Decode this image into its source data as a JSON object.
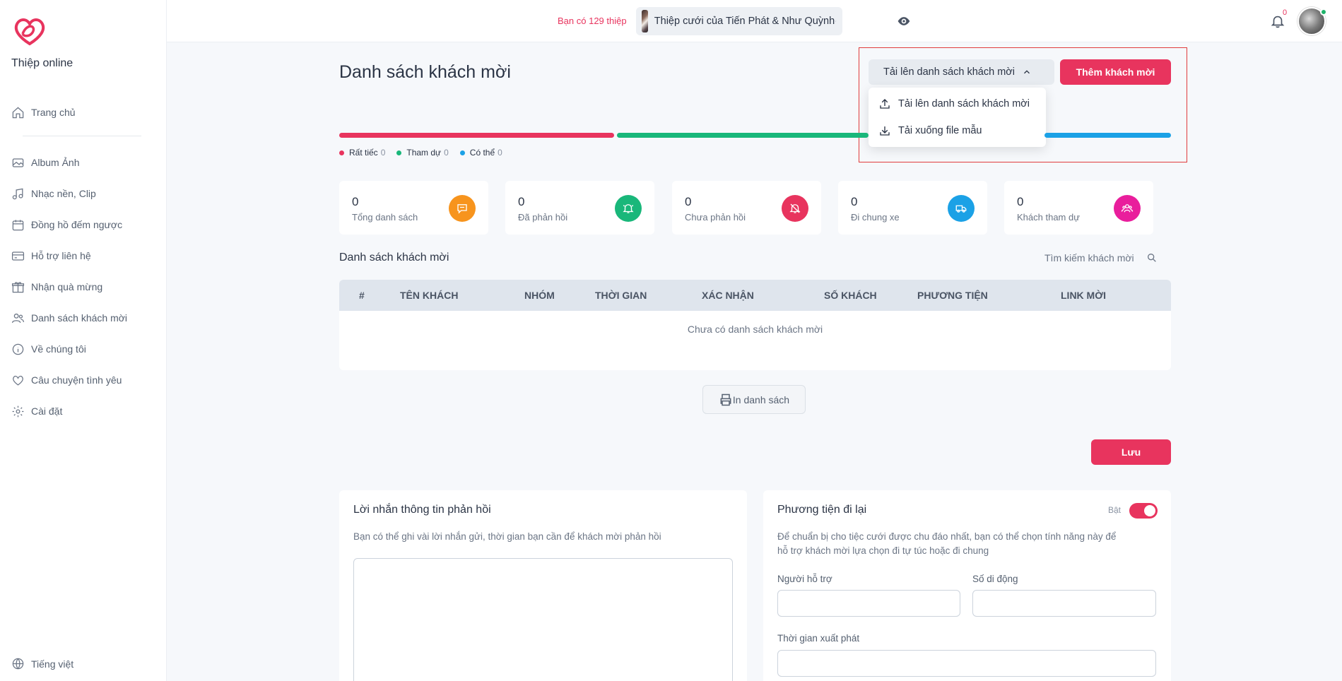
{
  "sidebar": {
    "brand": "Thiệp online",
    "items": [
      {
        "label": "Trang chủ",
        "icon": "home-icon"
      },
      {
        "label": "Album Ảnh",
        "icon": "image-icon"
      },
      {
        "label": "Nhạc nền, Clip",
        "icon": "music-icon"
      },
      {
        "label": "Đồng hồ đếm ngược",
        "icon": "calendar-icon"
      },
      {
        "label": "Hỗ trợ liên hệ",
        "icon": "card-icon"
      },
      {
        "label": "Nhận quà mừng",
        "icon": "gift-icon"
      },
      {
        "label": "Danh sách khách mời",
        "icon": "users-icon"
      },
      {
        "label": "Về chúng tôi",
        "icon": "info-icon"
      },
      {
        "label": "Câu chuyện tình yêu",
        "icon": "heart-icon"
      },
      {
        "label": "Cài đặt",
        "icon": "gear-icon"
      }
    ],
    "language": "Tiếng việt"
  },
  "topbar": {
    "card_count_text": "Bạn có 129 thiệp",
    "selected_card": "Thiệp cưới của Tiến Phát & Như Quỳnh",
    "notification_count": "0"
  },
  "main": {
    "title": "Danh sách khách mời",
    "upload_button": "Tải lên danh sách khách mời",
    "add_button": "Thêm khách mời",
    "dropdown": [
      {
        "label": "Tải lên danh sách khách mời",
        "icon": "upload-icon"
      },
      {
        "label": "Tải xuống file mẫu",
        "icon": "download-icon"
      }
    ],
    "legend": [
      {
        "label": "Rất tiếc",
        "value": "0",
        "color": "#e8345e"
      },
      {
        "label": "Tham dự",
        "value": "0",
        "color": "#19b77a"
      },
      {
        "label": "Có thể",
        "value": "0",
        "color": "#1ba1e6"
      }
    ],
    "stats": [
      {
        "value": "0",
        "label": "Tổng danh sách",
        "color": "#f7941d",
        "icon": "message-icon"
      },
      {
        "value": "0",
        "label": "Đã phản hồi",
        "color": "#19b77a",
        "icon": "bell-ring-icon"
      },
      {
        "value": "0",
        "label": "Chưa phản hồi",
        "color": "#e8345e",
        "icon": "bell-off-icon"
      },
      {
        "value": "0",
        "label": "Đi chung xe",
        "color": "#1ba1e6",
        "icon": "truck-icon"
      },
      {
        "value": "0",
        "label": "Khách tham dự",
        "color": "#e91e9c",
        "icon": "group-icon"
      }
    ],
    "list_title": "Danh sách khách mời",
    "search_placeholder": "Tìm kiếm khách mời",
    "table": {
      "headers": [
        "#",
        "TÊN KHÁCH",
        "NHÓM",
        "THỜI GIAN",
        "XÁC NHẬN",
        "SỐ KHÁCH",
        "PHƯƠNG TIỆN",
        "LINK MỜI"
      ],
      "empty_text": "Chưa có danh sách khách mời"
    },
    "print_button": "In danh sách",
    "save_button": "Lưu"
  },
  "feedback_panel": {
    "title": "Lời nhắn thông tin phản hồi",
    "description": "Bạn có thể ghi vài lời nhắn gửi, thời gian bạn cần để khách mời phản hồi"
  },
  "transport_panel": {
    "title": "Phương tiện đi lại",
    "toggle_label": "Bật",
    "description_line1": "Để chuẩn bị cho tiệc cưới được chu đáo nhất, bạn có thể chọn tính năng này để",
    "description_line2": "hỗ trợ khách mời lựa chọn đi tự túc hoặc đi chung",
    "supporter_label": "Người hỗ trợ",
    "phone_label": "Số di động",
    "depart_time_label": "Thời gian xuất phát"
  }
}
